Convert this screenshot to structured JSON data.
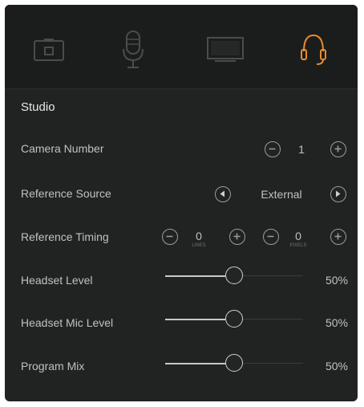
{
  "tabs": [
    {
      "name": "camera-tab",
      "icon": "camera-icon",
      "active": false
    },
    {
      "name": "audio-tab",
      "icon": "microphone-icon",
      "active": false
    },
    {
      "name": "display-tab",
      "icon": "monitor-icon",
      "active": false
    },
    {
      "name": "headset-tab",
      "icon": "headset-icon",
      "active": true
    }
  ],
  "colors": {
    "accent": "#e88b2c",
    "inactive_icon": "#4a4d4d",
    "text": "#bfc2c2"
  },
  "section_title": "Studio",
  "camera_number": {
    "label": "Camera Number",
    "value": "1"
  },
  "reference_source": {
    "label": "Reference Source",
    "value": "External"
  },
  "reference_timing": {
    "label": "Reference Timing",
    "lines": {
      "value": "0",
      "unit": "LINES"
    },
    "pixels": {
      "value": "0",
      "unit": "PIXELS"
    }
  },
  "headset_level": {
    "label": "Headset Level",
    "value": "50%",
    "fraction": 0.5
  },
  "headset_mic_level": {
    "label": "Headset Mic Level",
    "value": "50%",
    "fraction": 0.5
  },
  "program_mix": {
    "label": "Program Mix",
    "value": "50%",
    "fraction": 0.5
  }
}
